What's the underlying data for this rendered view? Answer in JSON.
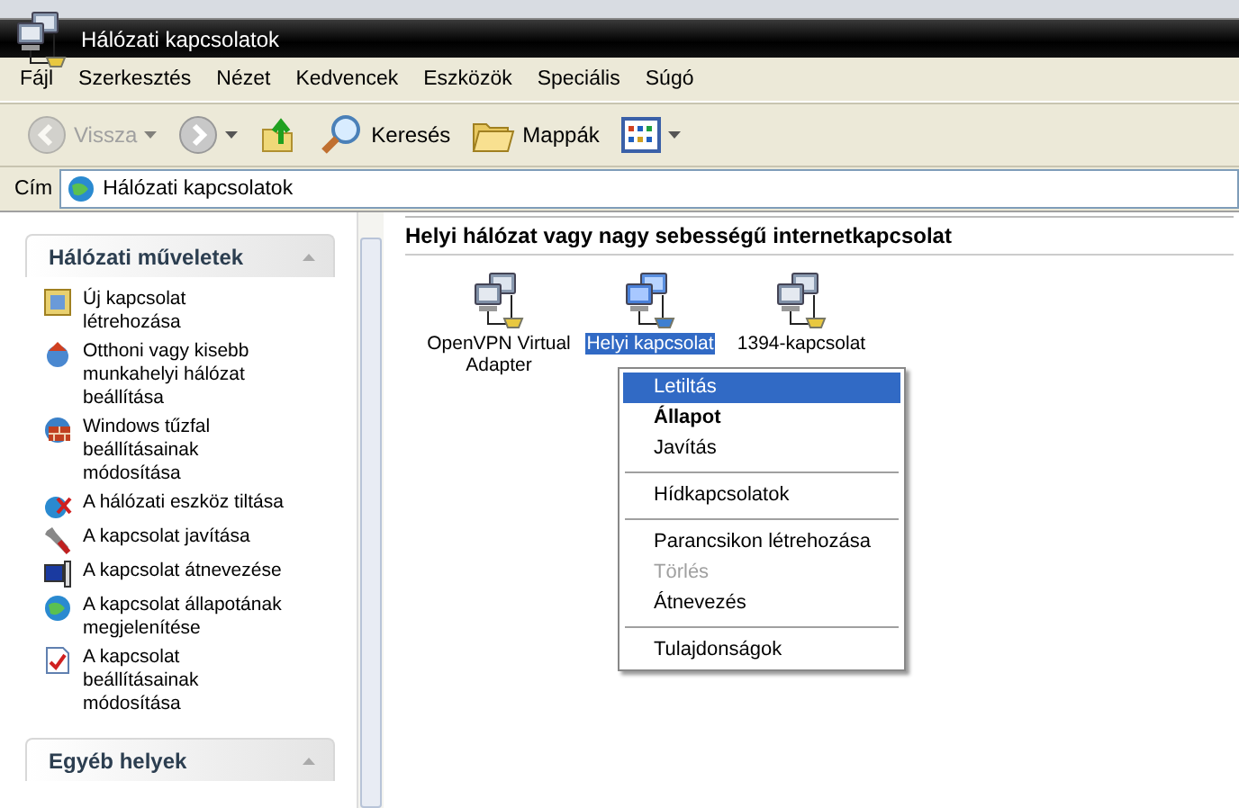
{
  "window": {
    "title": "Hálózati kapcsolatok"
  },
  "menu_bar": [
    "Fájl",
    "Szerkesztés",
    "Nézet",
    "Kedvencek",
    "Eszközök",
    "Speciális",
    "Súgó"
  ],
  "toolbar": [
    {
      "kind": "back",
      "label": "Vissza",
      "disabled": true
    },
    {
      "kind": "forward",
      "disabled": false
    },
    {
      "kind": "up"
    },
    {
      "kind": "search",
      "label": "Keresés"
    },
    {
      "kind": "folders",
      "label": "Mappák"
    },
    {
      "kind": "views"
    }
  ],
  "address_bar": {
    "label": "Cím",
    "value": "Hálózati kapcsolatok"
  },
  "sidebar": {
    "panels": [
      {
        "title": "Hálózati műveletek",
        "expanded": true,
        "items": [
          {
            "kind": "new",
            "label": "Új kapcsolat létrehozása"
          },
          {
            "kind": "home",
            "label": "Otthoni vagy kisebb munkahelyi hálózat beállítása"
          },
          {
            "kind": "firewall",
            "label": "Windows tűzfal beállításainak módosítása"
          },
          {
            "kind": "disable",
            "label": "A hálózati eszköz tiltása"
          },
          {
            "kind": "repair",
            "label": "A kapcsolat javítása"
          },
          {
            "kind": "rename",
            "label": "A kapcsolat átnevezése"
          },
          {
            "kind": "status",
            "label": "A kapcsolat állapotának megjelenítése"
          },
          {
            "kind": "settings",
            "label": "A kapcsolat beállításainak módosítása"
          }
        ]
      },
      {
        "title": "Egyéb helyek",
        "expanded": true
      }
    ]
  },
  "content": {
    "group_title": "Helyi hálózat vagy nagy sebességű internetkapcsolat",
    "connections": [
      {
        "label": "OpenVPN Virtual Adapter",
        "selected": false
      },
      {
        "label": "Helyi kapcsolat",
        "selected": true
      },
      {
        "label": "1394-kapcsolat",
        "selected": false
      }
    ]
  },
  "context_menu": [
    {
      "kind": "item",
      "label": "Letiltás",
      "selected": true,
      "default": false,
      "disabled": false
    },
    {
      "kind": "item",
      "label": "Állapot",
      "selected": false,
      "default": true,
      "disabled": false
    },
    {
      "kind": "item",
      "label": "Javítás",
      "selected": false,
      "default": false,
      "disabled": false
    },
    {
      "kind": "separator"
    },
    {
      "kind": "item",
      "label": "Hídkapcsolatok",
      "selected": false,
      "default": false,
      "disabled": false
    },
    {
      "kind": "separator"
    },
    {
      "kind": "item",
      "label": "Parancsikon létrehozása",
      "selected": false,
      "default": false,
      "disabled": false
    },
    {
      "kind": "item",
      "label": "Törlés",
      "selected": false,
      "default": false,
      "disabled": true
    },
    {
      "kind": "item",
      "label": "Átnevezés",
      "selected": false,
      "default": false,
      "disabled": false
    },
    {
      "kind": "separator"
    },
    {
      "kind": "item",
      "label": "Tulajdonságok",
      "selected": false,
      "default": false,
      "disabled": false
    }
  ]
}
